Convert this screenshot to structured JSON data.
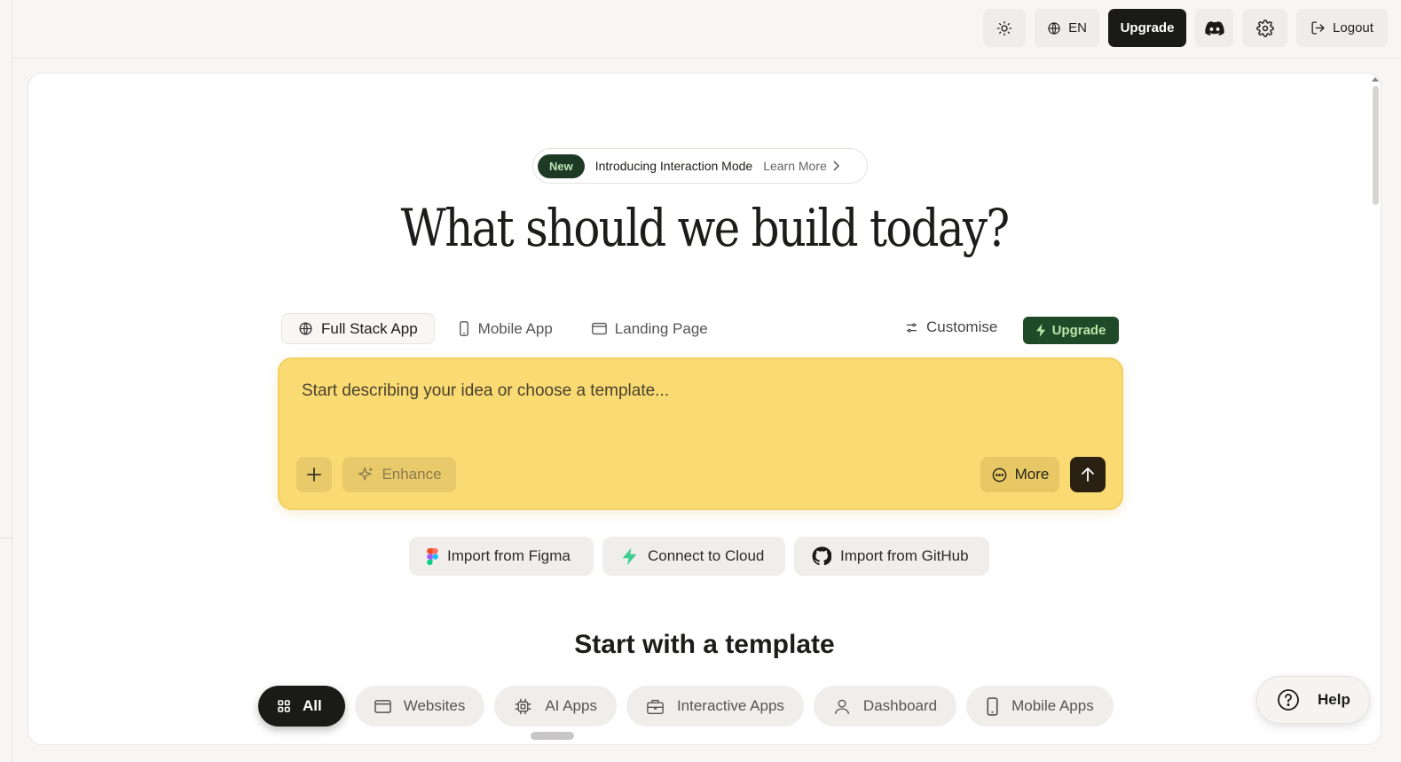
{
  "topbar": {
    "language_label": "EN",
    "upgrade_label": "Upgrade",
    "logout_label": "Logout"
  },
  "announcement": {
    "badge": "New",
    "text": "Introducing Interaction Mode",
    "link": "Learn More"
  },
  "hero": {
    "title": "What should we build today?"
  },
  "mode_tabs": [
    {
      "label": "Full Stack App",
      "icon": "globe-icon",
      "active": true
    },
    {
      "label": "Mobile App",
      "icon": "phone-icon",
      "active": false
    },
    {
      "label": "Landing Page",
      "icon": "window-icon",
      "active": false
    }
  ],
  "customise_label": "Customise",
  "upgrade_green_label": "Upgrade",
  "prompt": {
    "placeholder": "Start describing your idea or choose a template...",
    "enhance_label": "Enhance",
    "more_label": "More"
  },
  "imports": [
    {
      "label": "Import from Figma",
      "icon": "figma-icon"
    },
    {
      "label": "Connect to Cloud",
      "icon": "bolt-icon"
    },
    {
      "label": "Import from GitHub",
      "icon": "github-icon"
    }
  ],
  "templates": {
    "title": "Start with a template",
    "categories": [
      {
        "label": "All",
        "icon": "grid-icon",
        "active": true
      },
      {
        "label": "Websites",
        "icon": "browser-icon",
        "active": false
      },
      {
        "label": "AI Apps",
        "icon": "chip-icon",
        "active": false
      },
      {
        "label": "Interactive Apps",
        "icon": "briefcase-icon",
        "active": false
      },
      {
        "label": "Dashboard",
        "icon": "user-icon",
        "active": false
      },
      {
        "label": "Mobile Apps",
        "icon": "phone-icon",
        "active": false
      }
    ]
  },
  "help_label": "Help",
  "colors": {
    "prompt_bg": "#fadb73",
    "brand_green": "#1f4a27",
    "dark": "#1a1a18"
  }
}
